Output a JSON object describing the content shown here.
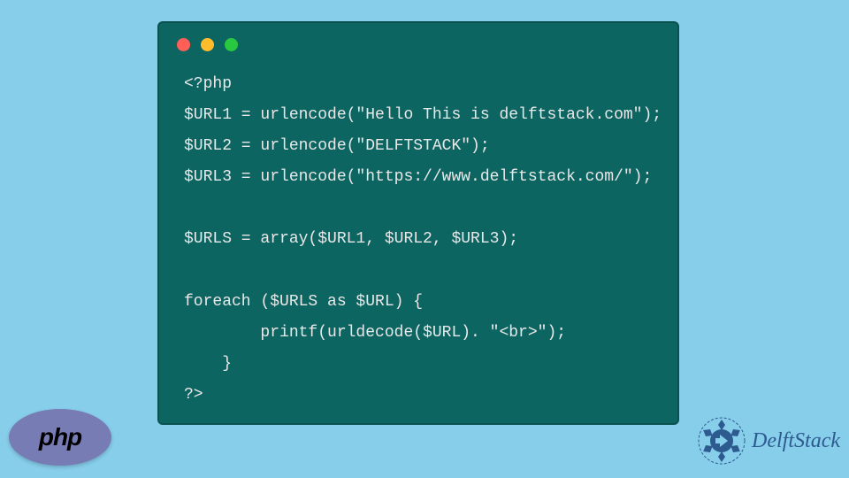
{
  "code": {
    "lines": [
      "<?php",
      "$URL1 = urlencode(\"Hello This is delftstack.com\");",
      "$URL2 = urlencode(\"DELFTSTACK\");",
      "$URL3 = urlencode(\"https://www.delftstack.com/\");",
      "",
      "$URLS = array($URL1, $URL2, $URL3);",
      "",
      "foreach ($URLS as $URL) {",
      "        printf(urldecode($URL). \"<br>\");",
      "    }",
      "?>"
    ]
  },
  "logos": {
    "php_text": "php",
    "delft_text": "DelftStack"
  }
}
